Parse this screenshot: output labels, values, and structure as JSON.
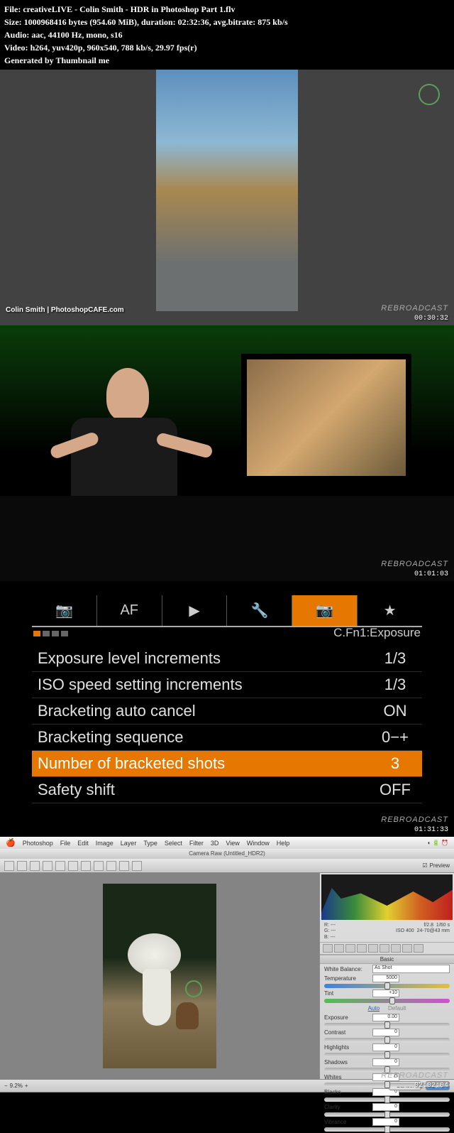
{
  "header": {
    "file_label": "File:",
    "file_value": "creativeLIVE - Colin Smith - HDR in Photoshop Part 1.flv",
    "size_label": "Size:",
    "size_value": "1000968416 bytes (954.60 MiB), duration: 02:32:36, avg.bitrate: 875 kb/s",
    "audio_label": "Audio:",
    "audio_value": "aac, 44100 Hz, mono, s16",
    "video_label": "Video:",
    "video_value": "h264, yuv420p, 960x540, 788 kb/s, 29.97 fps(r)",
    "generated": "Generated by Thumbnail me"
  },
  "frames": {
    "f1": {
      "timestamp": "00:30:32",
      "rebroadcast": "REBROADCAST",
      "credit": "Colin Smith | PhotoshopCAFE.com"
    },
    "f2": {
      "timestamp": "01:01:03",
      "rebroadcast": "REBROADCAST"
    },
    "f3": {
      "timestamp": "01:31:33",
      "rebroadcast": "REBROADCAST"
    },
    "f4": {
      "timestamp": "02:02:04",
      "rebroadcast": "REBROADCAST"
    }
  },
  "camera_menu": {
    "tabs": [
      "📷",
      "AF",
      "▶",
      "🔧",
      "📷",
      "★"
    ],
    "section": "C.Fn1:Exposure",
    "items": [
      {
        "label": "Exposure level increments",
        "value": "1/3"
      },
      {
        "label": "ISO speed setting increments",
        "value": "1/3"
      },
      {
        "label": "Bracketing auto cancel",
        "value": "ON"
      },
      {
        "label": "Bracketing sequence",
        "value": "0−+"
      },
      {
        "label": "Number of bracketed shots",
        "value": "3"
      },
      {
        "label": "Safety shift",
        "value": "OFF"
      }
    ]
  },
  "photoshop": {
    "menubar": [
      "Photoshop",
      "File",
      "Edit",
      "Image",
      "Layer",
      "Type",
      "Select",
      "Filter",
      "3D",
      "View",
      "Window",
      "Help"
    ],
    "title": "Camera Raw (Untitled_HDR2)",
    "preview": "Preview",
    "meta": {
      "r": "R: ---",
      "g": "G: ---",
      "b": "B: ---",
      "fstop": "f/2.8",
      "shutter": "1/60 s",
      "iso": "ISO 400",
      "lens": "24-70@43 mm"
    },
    "section_basic": "Basic",
    "wb_label": "White Balance:",
    "wb_value": "As Shot",
    "temp_label": "Temperature",
    "temp_value": "5000",
    "tint_label": "Tint",
    "tint_value": "+10",
    "auto": "Auto",
    "default": "Default",
    "sliders": [
      {
        "label": "Exposure",
        "value": "0.00"
      },
      {
        "label": "Contrast",
        "value": "0"
      },
      {
        "label": "Highlights",
        "value": "0"
      },
      {
        "label": "Shadows",
        "value": "0"
      },
      {
        "label": "Whites",
        "value": "0"
      },
      {
        "label": "Blacks",
        "value": "0"
      },
      {
        "label": "Clarity",
        "value": "0"
      },
      {
        "label": "Vibrance",
        "value": "0"
      }
    ],
    "zoom": "9.2%",
    "cancel": "Cancel",
    "ok": "OK"
  }
}
